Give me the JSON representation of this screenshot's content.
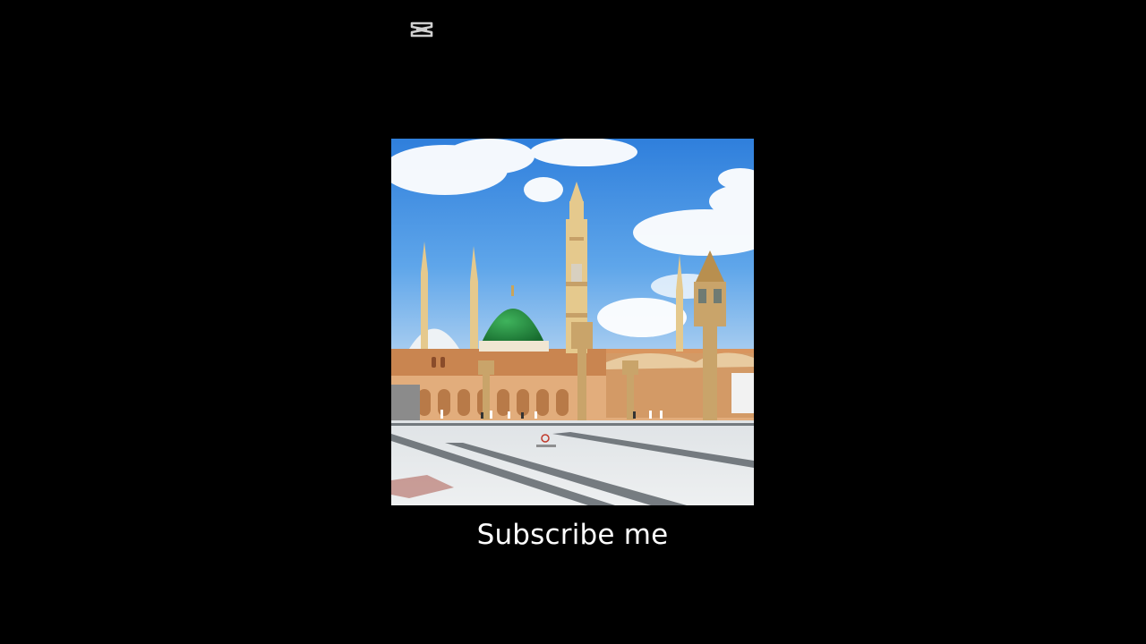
{
  "watermark": {
    "icon": "capcut-logo-icon"
  },
  "image": {
    "subject": "mosque-photo"
  },
  "caption": {
    "text": "Subscribe me"
  },
  "colors": {
    "background": "#000000",
    "caption_text": "#ffffff",
    "dome_green": "#1f8a3c"
  }
}
